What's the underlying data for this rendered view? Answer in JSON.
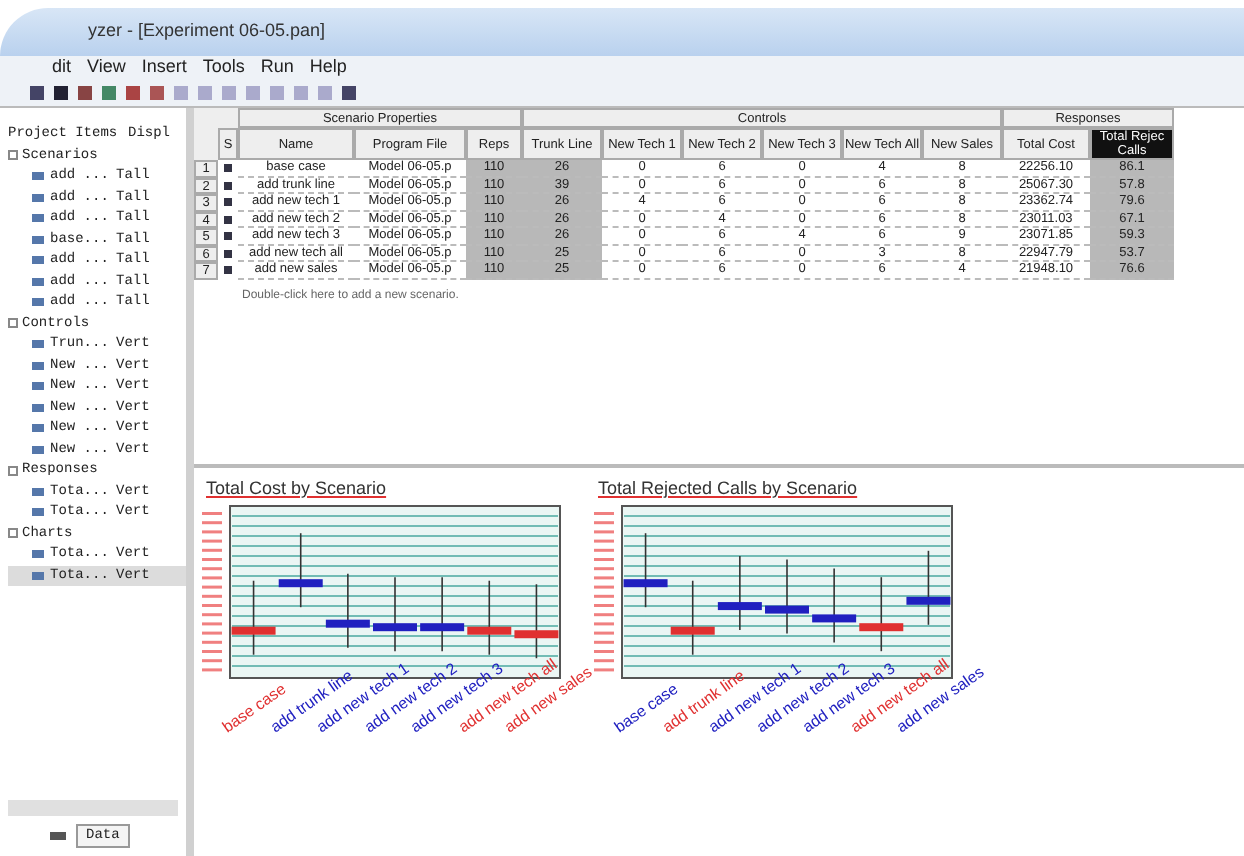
{
  "window": {
    "title": "yzer - [Experiment 06-05.pan]"
  },
  "menu": [
    "dit",
    "View",
    "Insert",
    "Tools",
    "Run",
    "Help"
  ],
  "project_tree": {
    "columns": [
      "Project Items",
      "Displ"
    ],
    "groups": [
      {
        "label": "Scenarios",
        "expanded": true,
        "children": [
          {
            "name": "add ...",
            "display": "Tall",
            "selected": false
          },
          {
            "name": "add ...",
            "display": "Tall",
            "selected": false
          },
          {
            "name": "add ...",
            "display": "Tall",
            "selected": false
          },
          {
            "name": "base...",
            "display": "Tall",
            "selected": false
          },
          {
            "name": "add ...",
            "display": "Tall",
            "selected": false
          },
          {
            "name": "add ...",
            "display": "Tall",
            "selected": false
          },
          {
            "name": "add ...",
            "display": "Tall",
            "selected": false
          }
        ]
      },
      {
        "label": "Controls",
        "expanded": true,
        "children": [
          {
            "name": "Trun...",
            "display": "Vert",
            "selected": false
          },
          {
            "name": "New ...",
            "display": "Vert",
            "selected": false
          },
          {
            "name": "New ...",
            "display": "Vert",
            "selected": false
          },
          {
            "name": "New ...",
            "display": "Vert",
            "selected": false
          },
          {
            "name": "New ...",
            "display": "Vert",
            "selected": false
          },
          {
            "name": "New ...",
            "display": "Vert",
            "selected": false
          }
        ]
      },
      {
        "label": "Responses",
        "expanded": true,
        "children": [
          {
            "name": "Tota...",
            "display": "Vert",
            "selected": false
          },
          {
            "name": "Tota...",
            "display": "Vert",
            "selected": false
          }
        ]
      },
      {
        "label": "Charts",
        "expanded": true,
        "children": [
          {
            "name": "Tota...",
            "display": "Vert",
            "selected": false
          },
          {
            "name": "Tota...",
            "display": "Vert",
            "selected": true
          }
        ]
      }
    ]
  },
  "bottom_tab": "Data",
  "grid": {
    "groups": [
      "Scenario Properties",
      "Controls",
      "Responses"
    ],
    "columns": [
      "S",
      "Name",
      "Program File",
      "Reps",
      "Trunk Line",
      "New Tech 1",
      "New Tech 2",
      "New Tech 3",
      "New Tech All",
      "New Sales",
      "Total Cost",
      "Total Rejec Calls"
    ],
    "rows": [
      {
        "num": "1",
        "name": "base case",
        "file": "Model 06-05.p",
        "reps": "110",
        "values": [
          "26",
          "0",
          "6",
          "0",
          "4",
          "8"
        ],
        "cost": "22256.10",
        "rejected": "86.1"
      },
      {
        "num": "2",
        "name": "add trunk line",
        "file": "Model 06-05.p",
        "reps": "110",
        "values": [
          "39",
          "0",
          "6",
          "0",
          "6",
          "8"
        ],
        "cost": "25067.30",
        "rejected": "57.8"
      },
      {
        "num": "3",
        "name": "add new tech 1",
        "file": "Model 06-05.p",
        "reps": "110",
        "values": [
          "26",
          "4",
          "6",
          "0",
          "6",
          "8"
        ],
        "cost": "23362.74",
        "rejected": "79.6"
      },
      {
        "num": "4",
        "name": "add new tech 2",
        "file": "Model 06-05.p",
        "reps": "110",
        "values": [
          "26",
          "0",
          "4",
          "0",
          "6",
          "8"
        ],
        "cost": "23011.03",
        "rejected": "67.1"
      },
      {
        "num": "5",
        "name": "add new tech 3",
        "file": "Model 06-05.p",
        "reps": "110",
        "values": [
          "26",
          "0",
          "6",
          "4",
          "6",
          "9"
        ],
        "cost": "23071.85",
        "rejected": "59.3"
      },
      {
        "num": "6",
        "name": "add new tech all",
        "file": "Model 06-05.p",
        "reps": "110",
        "values": [
          "25",
          "0",
          "6",
          "0",
          "3",
          "8"
        ],
        "cost": "22947.79",
        "rejected": "53.7"
      },
      {
        "num": "7",
        "name": "add new sales",
        "file": "Model 06-05.p",
        "reps": "110",
        "values": [
          "25",
          "0",
          "6",
          "0",
          "6",
          "4"
        ],
        "cost": "21948.10",
        "rejected": "76.6"
      }
    ],
    "add_hint": "Double-click here to add a new scenario."
  },
  "charts": [
    {
      "title": "Total Cost by Scenario",
      "categories": [
        {
          "label": "base case",
          "color": "#e03030"
        },
        {
          "label": "add trunk line",
          "color": "#2020c0"
        },
        {
          "label": "add new tech 1",
          "color": "#2020c0"
        },
        {
          "label": "add new tech 2",
          "color": "#2020c0"
        },
        {
          "label": "add new tech 3",
          "color": "#2020c0"
        },
        {
          "label": "add new tech all",
          "color": "#e03030"
        },
        {
          "label": "add new sales",
          "color": "#e03030"
        }
      ]
    },
    {
      "title": "Total Rejected Calls by Scenario",
      "categories": [
        {
          "label": "base case",
          "color": "#2020c0"
        },
        {
          "label": "add trunk line",
          "color": "#e03030"
        },
        {
          "label": "add new tech 1",
          "color": "#2020c0"
        },
        {
          "label": "add new tech 2",
          "color": "#2020c0"
        },
        {
          "label": "add new tech 3",
          "color": "#2020c0"
        },
        {
          "label": "add new tech all",
          "color": "#e03030"
        },
        {
          "label": "add new sales",
          "color": "#2020c0"
        }
      ]
    }
  ]
}
